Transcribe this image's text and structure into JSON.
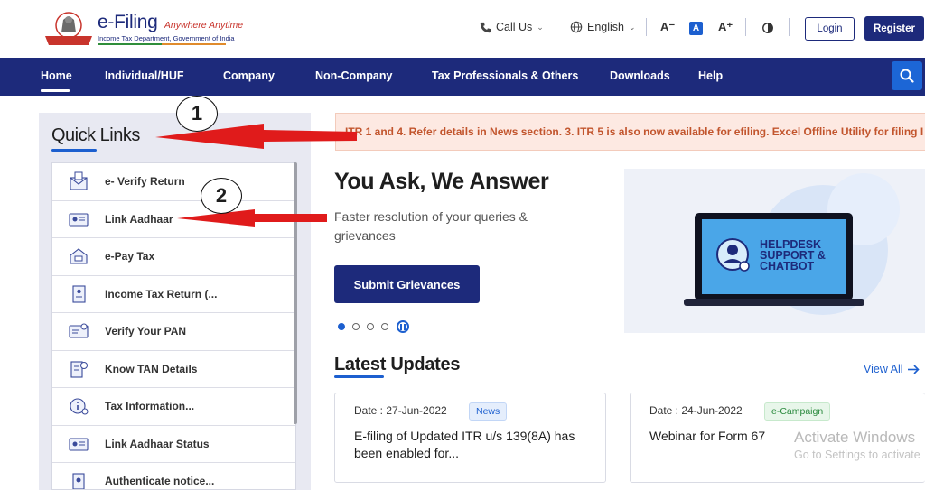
{
  "header": {
    "brand_title": "e-Filing",
    "brand_tagline": "Anywhere Anytime",
    "brand_sub": "Income Tax Department, Government of India",
    "call_us": "Call Us",
    "language": "English",
    "font_decrease": "A⁻",
    "font_default": "A",
    "font_increase": "A⁺",
    "login": "Login",
    "register": "Register"
  },
  "nav": {
    "items": [
      "Home",
      "Individual/HUF",
      "Company",
      "Non-Company",
      "Tax Professionals & Others",
      "Downloads",
      "Help"
    ]
  },
  "quick_links": {
    "title": "Quick Links",
    "items": [
      {
        "label": "e- Verify Return",
        "icon": "verify-return-icon"
      },
      {
        "label": "Link Aadhaar",
        "icon": "id-card-icon"
      },
      {
        "label": "e-Pay Tax",
        "icon": "pay-tax-icon"
      },
      {
        "label": "Income Tax Return (...",
        "icon": "itr-document-icon"
      },
      {
        "label": "Verify Your PAN",
        "icon": "pan-card-icon"
      },
      {
        "label": "Know TAN Details",
        "icon": "tan-document-icon"
      },
      {
        "label": "Tax Information...",
        "icon": "info-icon"
      },
      {
        "label": "Link Aadhaar Status",
        "icon": "id-card-icon"
      },
      {
        "label": "Authenticate notice...",
        "icon": "notice-document-icon"
      }
    ]
  },
  "ticker": {
    "text": "ITR 1 and 4. Refer details in News section. 3. ITR 5 is also now available for efiling. Excel Offline Utility for filing I"
  },
  "hero": {
    "title": "You Ask, We Answer",
    "subtitle": "Faster resolution of your queries & grievances",
    "button": "Submit Grievances",
    "image_text": [
      "HELPDESK",
      "SUPPORT &",
      "CHATBOT"
    ],
    "slide_count": 4,
    "active_slide": 1
  },
  "latest_updates": {
    "title": "Latest Updates",
    "view_all": "View All",
    "cards": [
      {
        "date": "Date : 27-Jun-2022",
        "badge": "News",
        "text": "E-filing of Updated ITR u/s 139(8A) has been enabled for..."
      },
      {
        "date": "Date : 24-Jun-2022",
        "badge": "e-Campaign",
        "text": "Webinar for Form 67"
      }
    ]
  },
  "watermark": {
    "line1": "Activate Windows",
    "line2": "Go to Settings to activate"
  },
  "annotations": {
    "marker1": "1",
    "marker2": "2"
  },
  "colors": {
    "primary": "#1d2a7b",
    "accent": "#1c5fcf",
    "ticker_text": "#c2552d",
    "annotation_arrow": "#e01b1b"
  }
}
